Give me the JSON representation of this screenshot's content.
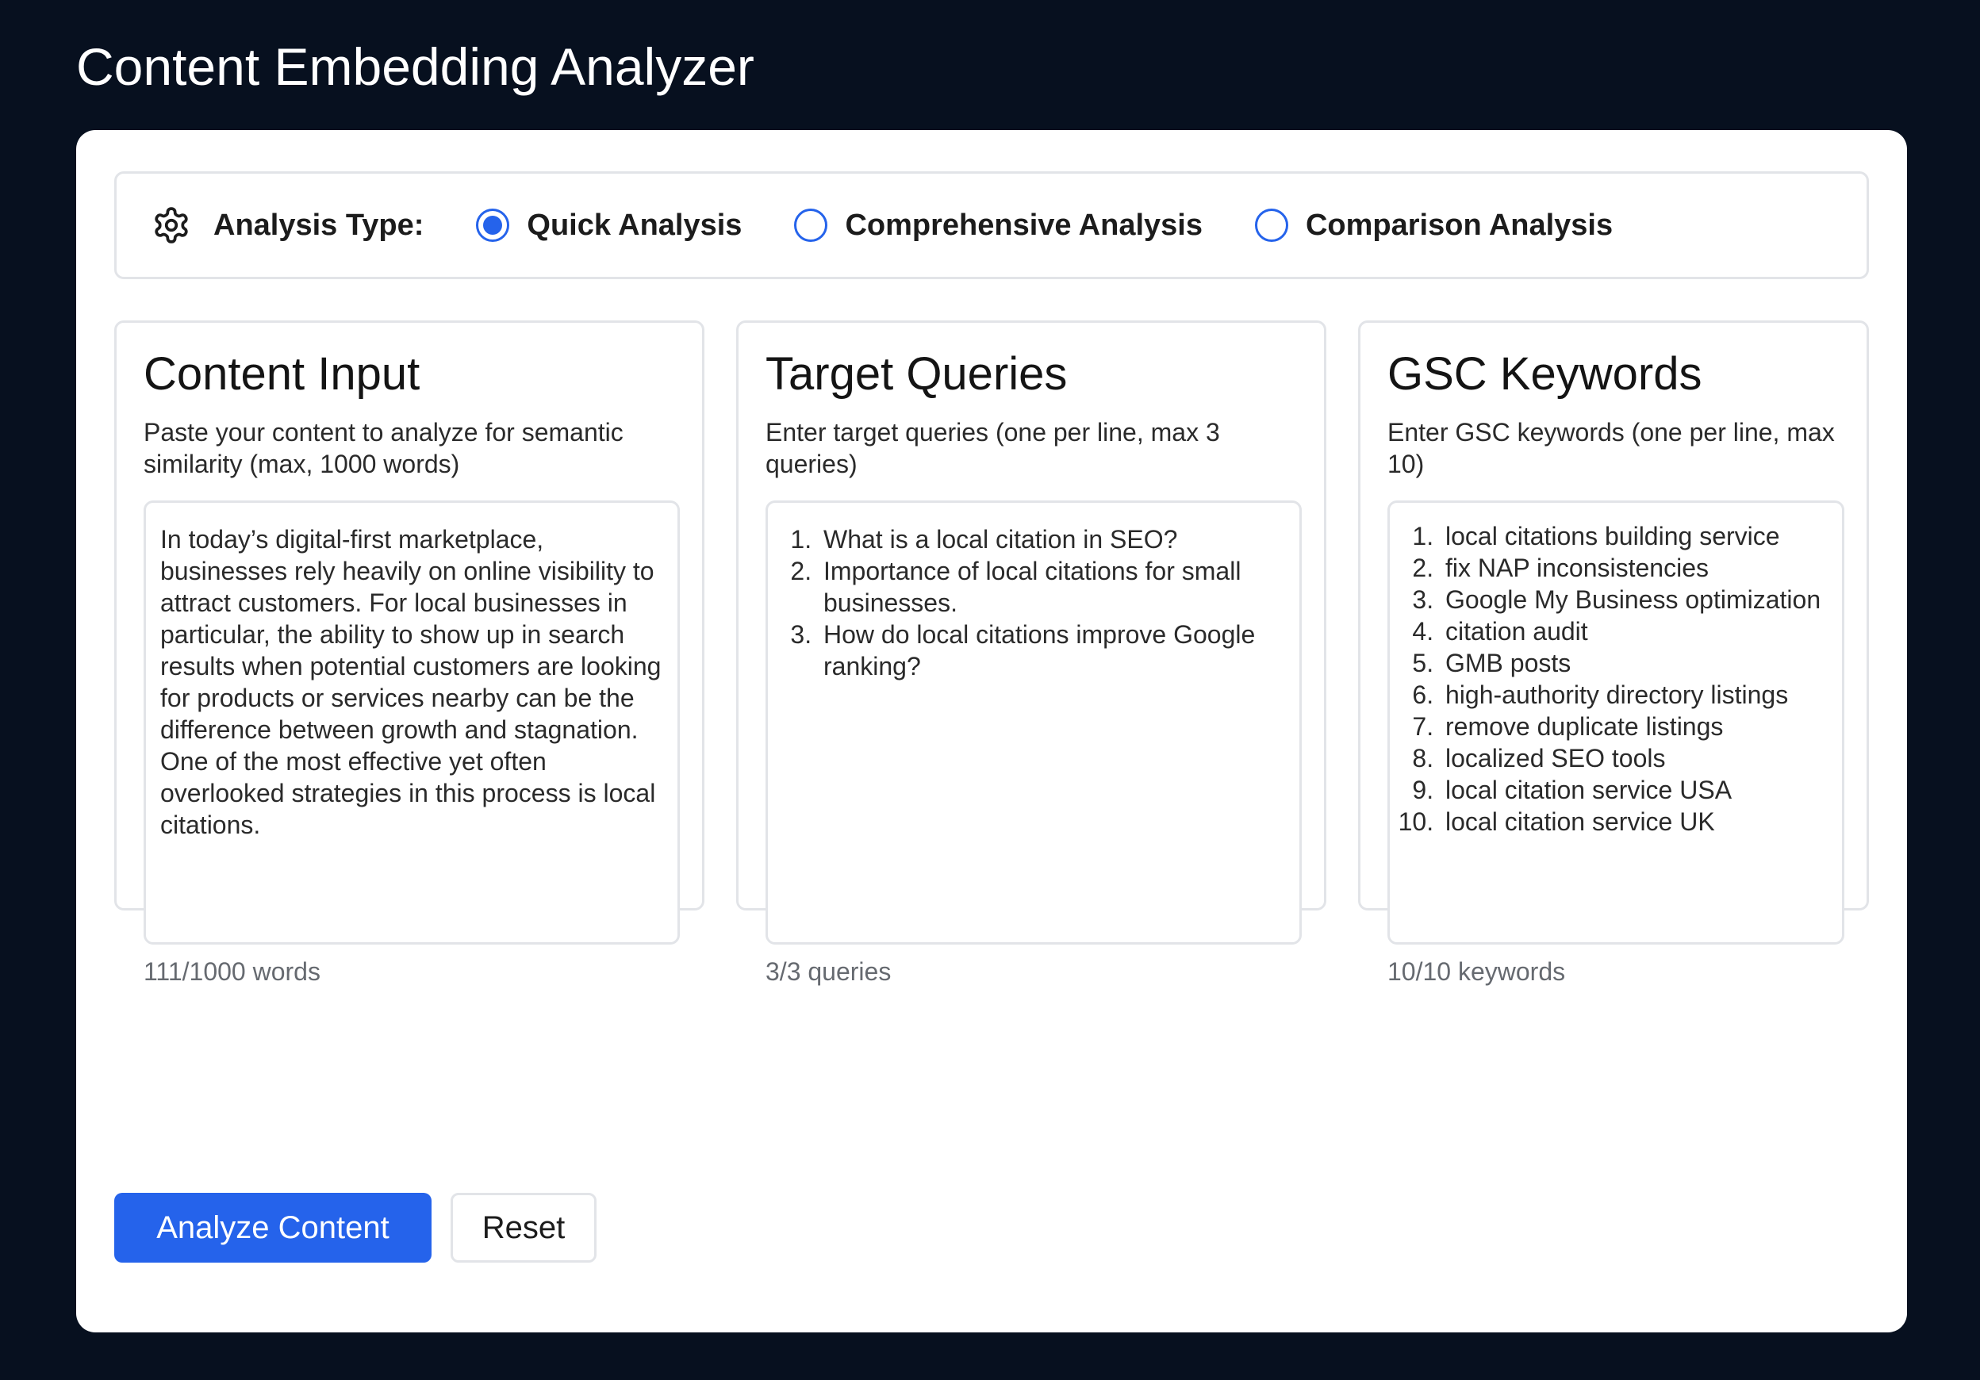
{
  "app": {
    "title": "Content Embedding Analyzer"
  },
  "analysis_type": {
    "label": "Analysis Type:",
    "icon": "gear-icon",
    "options": [
      {
        "label": "Quick Analysis",
        "checked": true
      },
      {
        "label": "Comprehensive Analysis",
        "checked": false
      },
      {
        "label": "Comparison Analysis",
        "checked": false
      }
    ]
  },
  "content_panel": {
    "title": "Content Input",
    "description": "Paste your content to analyze for semantic similarity (max, 1000 words)",
    "value": "In today’s digital-first marketplace, businesses rely heavily on online visibility to attract customers. For local businesses in particular, the ability to show up in search results when potential customers are looking for products or services nearby can be the difference between growth and stagnation. One of the most effective yet often overlooked strategies in this process is local citations.",
    "counter": "111/1000 words"
  },
  "queries_panel": {
    "title": "Target Queries",
    "description": "Enter target queries (one per line, max 3 queries)",
    "items": [
      "What is a local citation in SEO?",
      "Importance of local citations for small businesses.",
      "How do local citations improve Google ranking?"
    ],
    "counter": "3/3 queries"
  },
  "keywords_panel": {
    "title": "GSC Keywords",
    "description": "Enter GSC keywords (one per line, max 10)",
    "items": [
      "local citations building service",
      "fix NAP inconsistencies",
      "Google My Business optimization",
      "citation audit",
      "GMB posts",
      "high-authority directory listings",
      "remove duplicate listings",
      "localized SEO tools",
      "local citation service USA",
      "local citation service UK"
    ],
    "counter": "10/10 keywords"
  },
  "actions": {
    "analyze_label": "Analyze Content",
    "reset_label": "Reset"
  },
  "colors": {
    "page_background": "#07101f",
    "card_background": "#ffffff",
    "accent": "#2563eb",
    "border": "#e2e4e8",
    "muted_text": "#666a70"
  }
}
